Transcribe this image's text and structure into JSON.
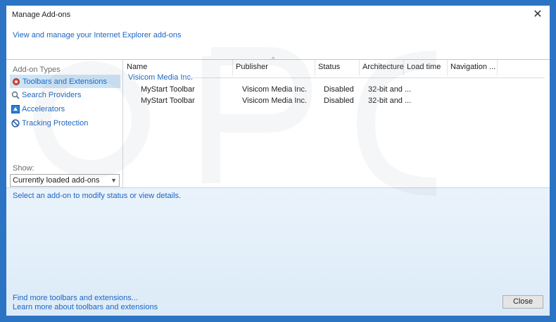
{
  "window": {
    "title": "Manage Add-ons",
    "close_glyph": "✕"
  },
  "header": {
    "subtitle": "View and manage your Internet Explorer add-ons"
  },
  "sidebar": {
    "types_label": "Add-on Types",
    "items": [
      {
        "label": "Toolbars and Extensions",
        "icon": "gear-icon",
        "selected": true
      },
      {
        "label": "Search Providers",
        "icon": "search-icon",
        "selected": false
      },
      {
        "label": "Accelerators",
        "icon": "accelerator-icon",
        "selected": false
      },
      {
        "label": "Tracking Protection",
        "icon": "block-icon",
        "selected": false
      }
    ],
    "show_label": "Show:",
    "show_value": "Currently loaded add-ons"
  },
  "list": {
    "columns": [
      "Name",
      "Publisher",
      "Status",
      "Architecture",
      "Load time",
      "Navigation ..."
    ],
    "group": "Visicom Media Inc.",
    "rows": [
      {
        "name": "MyStart Toolbar",
        "publisher": "Visicom Media Inc.",
        "status": "Disabled",
        "architecture": "32-bit and ..."
      },
      {
        "name": "MyStart Toolbar",
        "publisher": "Visicom Media Inc.",
        "status": "Disabled",
        "architecture": "32-bit and ..."
      }
    ]
  },
  "details": {
    "message": "Select an add-on to modify status or view details.",
    "link_more": "Find more toolbars and extensions...",
    "link_learn": "Learn more about toolbars and extensions",
    "close_label": "Close"
  },
  "colors": {
    "link": "#1c66c0",
    "selection": "#cce4f7",
    "frame": "#2b74c4"
  }
}
